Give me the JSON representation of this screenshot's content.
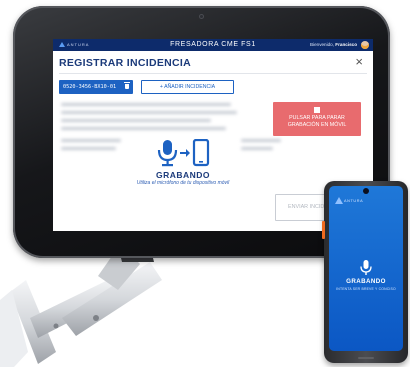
{
  "app": {
    "brand": "ANTURA",
    "title": "FRESADORA CME FS1",
    "greeting": "Bienvenido,",
    "user": "Francisco"
  },
  "modal": {
    "title": "REGISTRAR INCIDENCIA",
    "close_label": "×",
    "incident_code": "0520-3456-BX10-01",
    "add_button": "+ AÑADIR INCIDENCIA",
    "stop_button": "PULSAR PARA PARAR GRABACIÓN EN MÓVIL",
    "status": "GRABANDO",
    "hint": "Utiliza el micrófono de tu dispositivo móvil",
    "send_button": "ENVIAR INCIDENCIA"
  },
  "phone": {
    "brand": "ANTURA",
    "status": "GRABANDO",
    "hint": "INTENTA SER BREVE Y CONCISO"
  },
  "colors": {
    "appbar": "#0d2b6b",
    "accent": "#1d62c2",
    "stop": "#e86b6e",
    "phone_screen": "#0b57c4"
  },
  "icons": [
    "microphone-icon",
    "arrow-right-icon",
    "smartphone-icon",
    "trash-icon",
    "close-icon",
    "stop-icon"
  ]
}
